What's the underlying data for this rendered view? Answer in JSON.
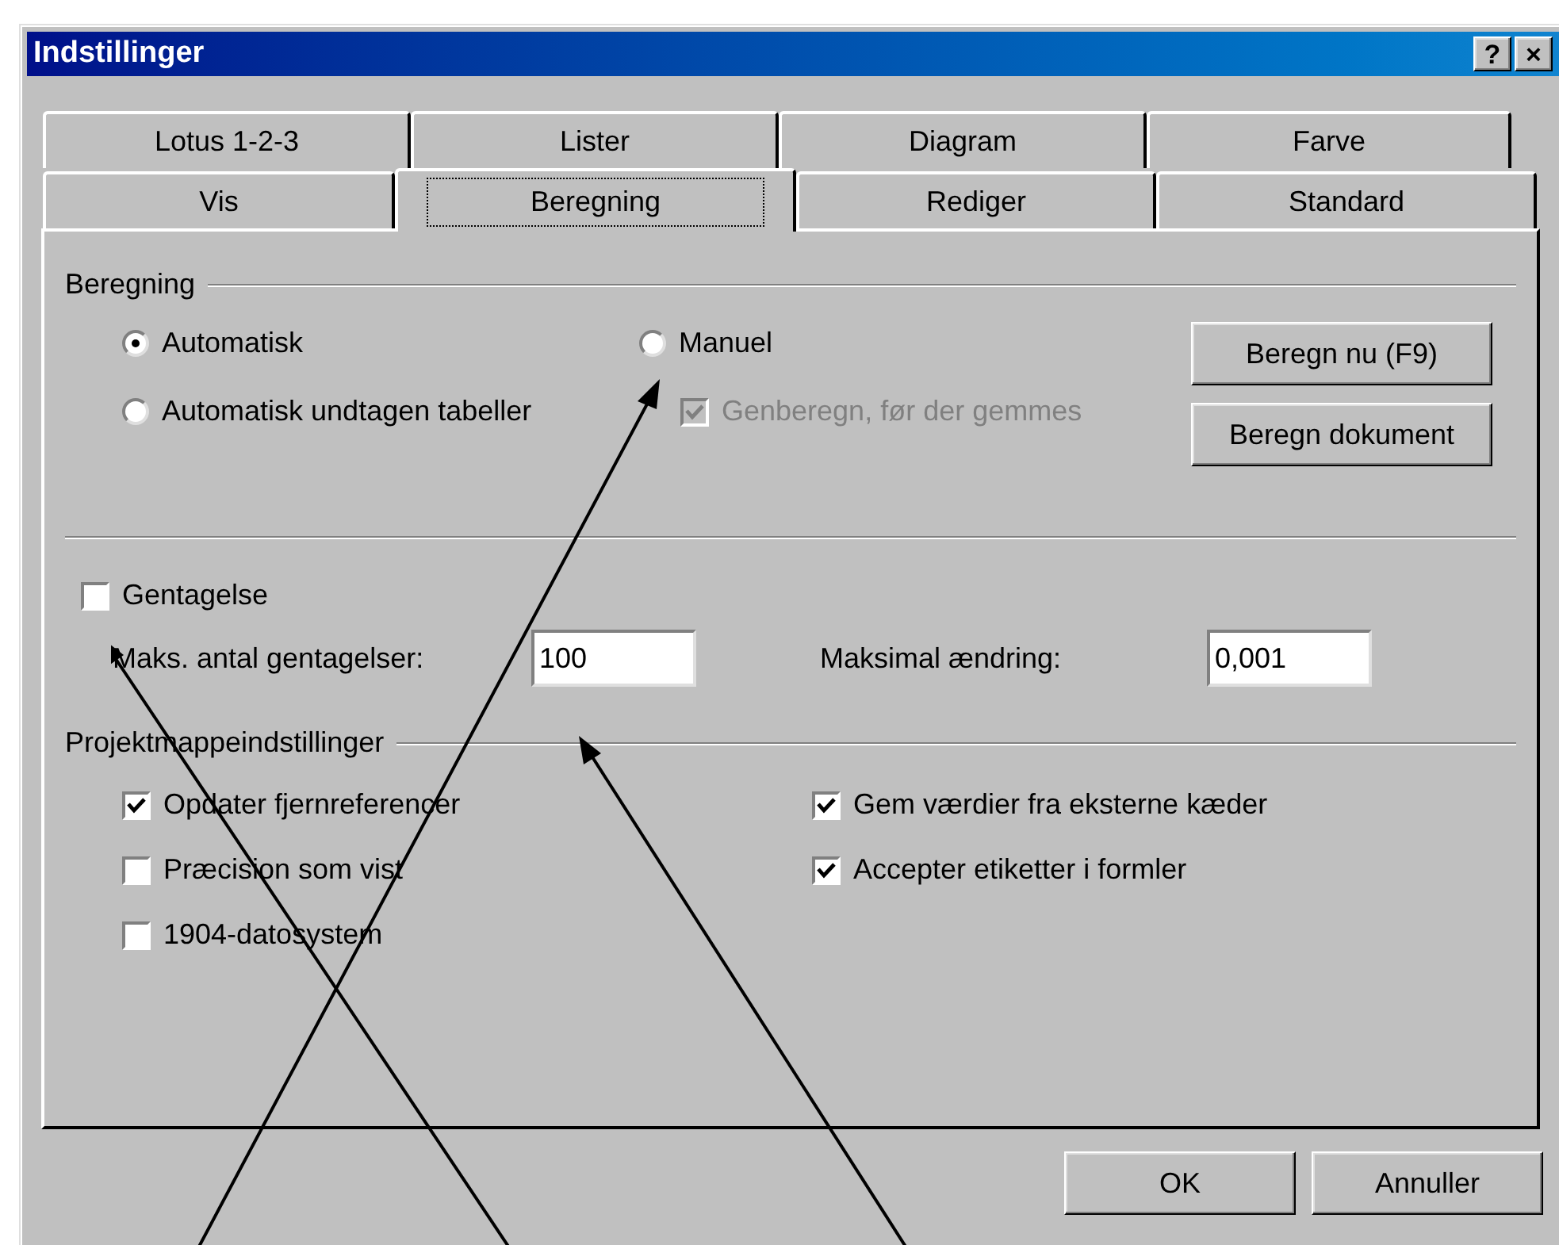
{
  "window": {
    "title": "Indstillinger",
    "buttons": [
      "?",
      "×"
    ]
  },
  "tab_rows": [
    [
      {
        "label": "Lotus 1-2-3",
        "selected": false
      },
      {
        "label": "Lister",
        "selected": false
      },
      {
        "label": "Diagram",
        "selected": false
      },
      {
        "label": "Farve",
        "selected": false
      }
    ],
    [
      {
        "label": "Vis",
        "selected": false
      },
      {
        "label": "Beregning",
        "selected": true
      },
      {
        "label": "Rediger",
        "selected": false
      },
      {
        "label": "Standard",
        "selected": false
      }
    ]
  ],
  "calculation": {
    "legend": "Beregning",
    "options": [
      {
        "label": "Automatisk",
        "selected": true
      },
      {
        "label": "Automatisk undtagen tabeller",
        "selected": false
      },
      {
        "label": "Manuel",
        "selected": false
      }
    ],
    "recalc_before_save": {
      "label": "Genberegn, før der gemmes",
      "checked": true,
      "disabled": true
    },
    "buttons": [
      "Beregn nu (F9)",
      "Beregn dokument"
    ]
  },
  "iteration": {
    "label": "Gentagelse",
    "checked": false,
    "max_iterations": {
      "label": "Maks. antal gentagelser:",
      "value": "100"
    },
    "max_change": {
      "label": "Maksimal ændring:",
      "value": "0,001"
    }
  },
  "workbook": {
    "legend": "Projektmappeindstillinger",
    "left_options": [
      {
        "label": "Opdater fjernreferencer",
        "checked": true
      },
      {
        "label": "Præcision som vist",
        "checked": false
      },
      {
        "label": "1904-datosystem",
        "checked": false
      }
    ],
    "right_options": [
      {
        "label": "Gem værdier fra eksterne kæder",
        "checked": true
      },
      {
        "label": "Accepter etiketter i formler",
        "checked": true
      }
    ]
  },
  "footer_buttons": [
    "OK",
    "Annuller"
  ]
}
